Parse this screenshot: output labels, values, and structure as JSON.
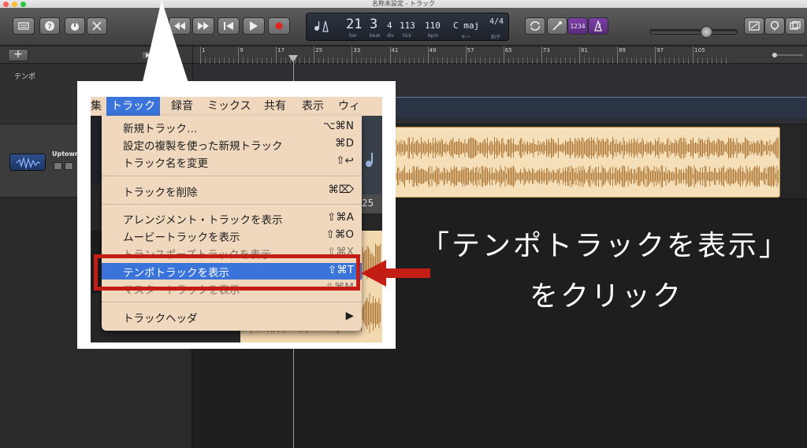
{
  "window": {
    "title": "名称未設定 - トラック"
  },
  "toolbar": {
    "library_icon": "library-icon",
    "help_icon": "help-icon",
    "smart_controls_icon": "smart-controls-icon",
    "editors_icon": "editors-icon",
    "rewind_icon": "rewind-icon",
    "forward_icon": "fast-forward-icon",
    "to_start_icon": "go-to-start-icon",
    "play_icon": "play-icon",
    "record_icon": "record-icon",
    "cycle_icon": "cycle-icon",
    "tuner_icon": "tuner-icon",
    "count_in": "1234",
    "metronome_icon": "metronome-icon",
    "notepad_icon": "notepad-icon",
    "loop_browser_icon": "loop-browser-icon",
    "media_browser_icon": "media-browser-icon"
  },
  "lcd": {
    "bar": "21",
    "beat": "3",
    "div": "4",
    "tick": "113",
    "bpm": "110",
    "key": "C maj",
    "time_signature": "4/4",
    "bar_cap": "bar",
    "beat_cap": "beat",
    "div_cap": "div",
    "tick_cap": "tick",
    "bpm_cap": "bpm",
    "key_cap": "キー",
    "sig_cap": "拍子"
  },
  "left_pane": {
    "add_label": "+",
    "tempo_label": "テンポ",
    "track_name": "Uptown"
  },
  "ruler": {
    "marks": [
      "1",
      "9",
      "17",
      "25",
      "33",
      "41",
      "49",
      "57",
      "65",
      "73",
      "81",
      "89",
      "97",
      "105"
    ]
  },
  "menu": {
    "menubar": [
      {
        "label": "集",
        "active": false
      },
      {
        "label": "トラック",
        "active": true
      },
      {
        "label": "録音",
        "active": false
      },
      {
        "label": "ミックス",
        "active": false
      },
      {
        "label": "共有",
        "active": false
      },
      {
        "label": "表示",
        "active": false
      },
      {
        "label": "ウィ",
        "active": false
      }
    ],
    "items": [
      {
        "label": "新規トラック…",
        "shortcut": "⌥⌘N"
      },
      {
        "label": "設定の複製を使った新規トラック",
        "shortcut": "⌘D"
      },
      {
        "label": "トラック名を変更",
        "shortcut": "⇧↩"
      },
      {
        "label": "トラックを削除",
        "shortcut": "⌘⌦"
      },
      {
        "label": "アレンジメント・トラックを表示",
        "shortcut": "⇧⌘A"
      },
      {
        "label": "ムービートラックを表示",
        "shortcut": "⇧⌘O"
      },
      {
        "label": "トランスポーズトラックを表示",
        "shortcut": "⇧⌘X"
      },
      {
        "label": "テンポトラックを表示",
        "shortcut": "⇧⌘T"
      },
      {
        "label": "マスタートラックを表示",
        "shortcut": "⇧⌘M"
      },
      {
        "label": "トラックヘッダ",
        "shortcut": "▶"
      }
    ],
    "background_number": "25"
  },
  "annotation": {
    "line1": "「テンポトラックを表示」",
    "line2": "をクリック",
    "highlight_color": "#c41d16"
  }
}
